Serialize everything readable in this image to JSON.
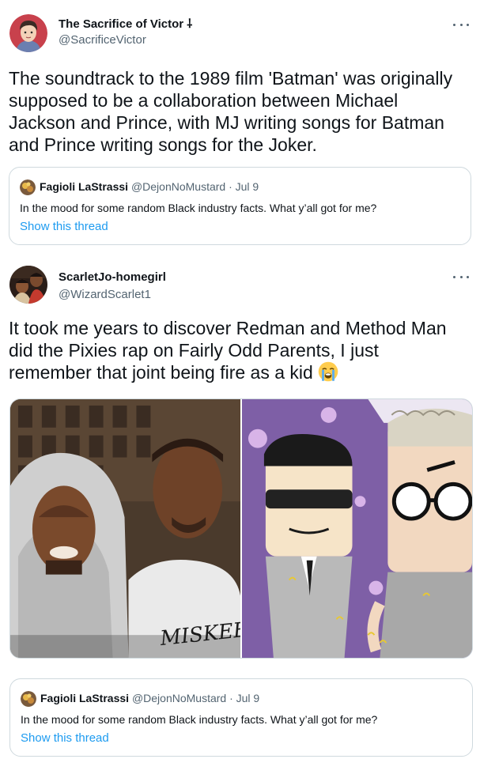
{
  "tweet1": {
    "name": "The Sacrifice of Victor ⸸",
    "handle": "@SacrificeVictor",
    "text": "The soundtrack to the 1989 film 'Batman' was originally supposed to be a collaboration between Michael Jackson and Prince, with MJ writing songs for Batman and Prince writing songs for the Joker.",
    "quote": {
      "name": "Fagioli LaStrassi",
      "meta": "@DejonNoMustard · Jul 9",
      "text": "In the mood for some random Black industry facts. What y’all got for me?",
      "link": "Show this thread"
    }
  },
  "tweet2": {
    "name": "ScarletJo-homegirl",
    "handle": "@WizardScarlet1",
    "text": "It took me years to discover Redman and Method Man did the Pixies rap on Fairly Odd Parents, I just remember that joint being fire as a kid",
    "emoji": "loudly-crying-face",
    "shirt_text": "MISKEEN",
    "quote": {
      "name": "Fagioli LaStrassi",
      "meta": "@DejonNoMustard · Jul 9",
      "text": "In the mood for some random Black industry facts. What y’all got for me?",
      "link": "Show this thread"
    }
  },
  "colors": {
    "text": "#0f1419",
    "secondary": "#536471",
    "link": "#1d9bf0",
    "border": "#cfd9de"
  }
}
